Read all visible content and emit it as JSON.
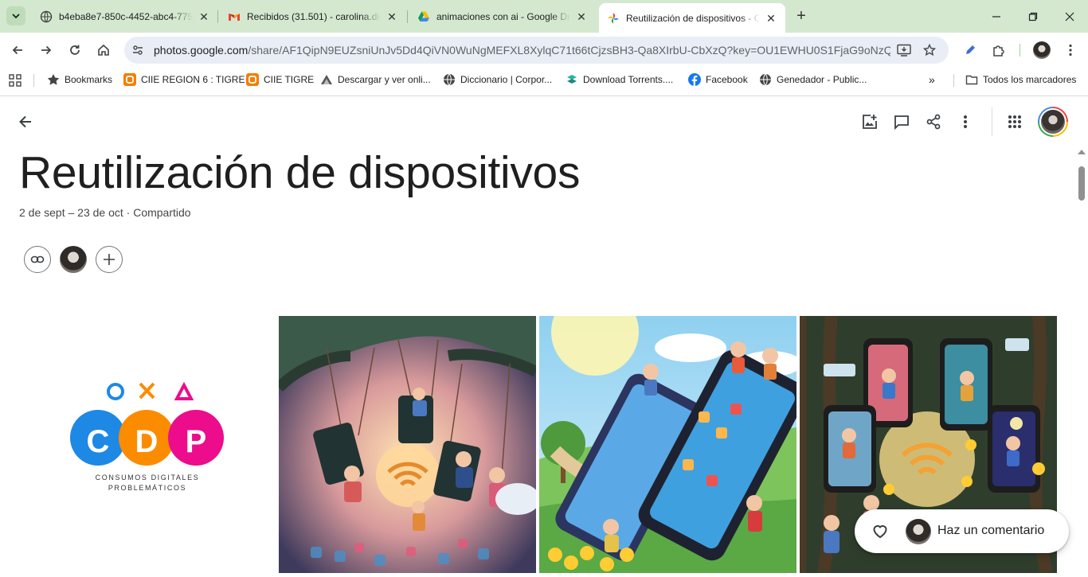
{
  "browser": {
    "tabs": [
      {
        "title": "b4eba8e7-850c-4452-abc4-775",
        "favicon": "globe-icon",
        "active": false
      },
      {
        "title": "Recibidos (31.501) - carolina.dip",
        "favicon": "gmail-icon",
        "active": false
      },
      {
        "title": "animaciones con ai - Google Dr",
        "favicon": "google-drive-icon",
        "active": false
      },
      {
        "title": "Reutilización de dispositivos - G",
        "favicon": "google-photos-icon",
        "active": true
      }
    ],
    "url_host": "photos.google.com",
    "url_path": "/share/AF1QipN9EUZsniUnJv5Dd4QiVN0WuNgMEFXL8XylqC71t66tCjzsBH3-Qa8XIrbU-CbXzQ?key=OU1EWHU0S1FjaG9oNzQxZ...",
    "bookmarks": [
      {
        "label": "Bookmarks",
        "icon": "star-icon"
      },
      {
        "label": "CIIE REGION 6 : TIGRE",
        "icon": "blogger-icon"
      },
      {
        "label": "CIIE TIGRE",
        "icon": "blogger-icon"
      },
      {
        "label": "Descargar y ver onli...",
        "icon": "bookmark-site-icon"
      },
      {
        "label": "Diccionario | Corpor...",
        "icon": "globe-icon"
      },
      {
        "label": "Download Torrents....",
        "icon": "torrent-icon"
      },
      {
        "label": "Facebook",
        "icon": "facebook-icon"
      },
      {
        "label": "Genedador - Public...",
        "icon": "globe-icon"
      }
    ],
    "all_bookmarks_label": "Todos los marcadores"
  },
  "album": {
    "title": "Reutilización de dispositivos",
    "subtitle": "2 de sept – 23 de oct · Compartido"
  },
  "logo": {
    "symbols": [
      "O",
      "X",
      "△"
    ],
    "letters": [
      "C",
      "D",
      "P"
    ],
    "line1": "CONSUMOS DIGITALES",
    "line2": "PROBLEMÁTICOS",
    "colors": {
      "c": "#1e88e5",
      "d": "#fb8c00",
      "p": "#ec0c8c"
    }
  },
  "comment": {
    "label": "Haz un comentario"
  },
  "colors": {
    "tabstrip": "#d4e8d0",
    "omnibox": "#e9eef6",
    "text": "#1f1f1f"
  }
}
